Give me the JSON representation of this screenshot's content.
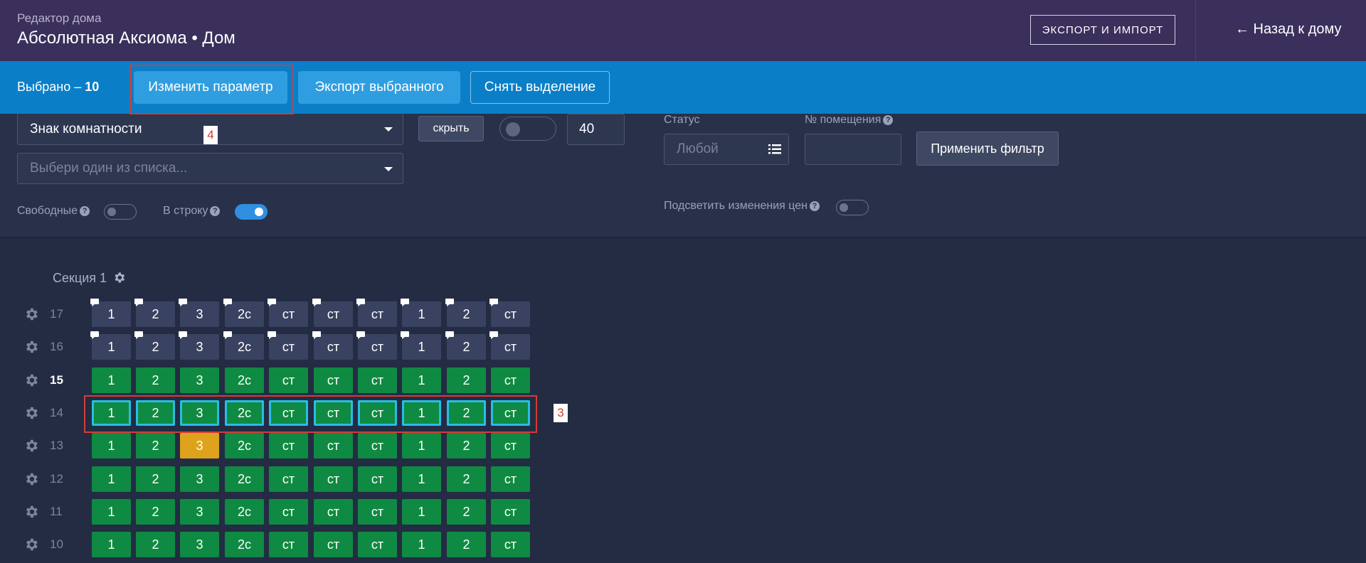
{
  "header": {
    "subtitle": "Редактор дома",
    "title": "Абсолютная Аксиома • Дом",
    "export_label": "ЭКСПОРТ И ИМПОРТ",
    "back_label": "← Назад к дому"
  },
  "selection": {
    "count_prefix": "Выбрано – ",
    "count": "10",
    "change_param": "Изменить параметр",
    "export_selected": "Экспорт выбранного",
    "clear_selection": "Снять выделение"
  },
  "annotations": {
    "label_4": "4",
    "label_3": "3"
  },
  "filters": {
    "room_sign": "Знак комнатности",
    "choose_placeholder": "Выбери один из списка...",
    "hide": "скрыть",
    "number": "40",
    "free_label": "Свободные",
    "inline_label": "В строку",
    "status_label": "Статус",
    "status_value": "Любой",
    "room_no_label": "№ помещения",
    "apply": "Применить фильтр",
    "highlight_label": "Подсветить изменения цен",
    "question": "?"
  },
  "section": {
    "title": "Секция 1",
    "rows": [
      {
        "floor": "17",
        "bold": false,
        "cells": [
          {
            "t": "1",
            "s": "empty"
          },
          {
            "t": "2",
            "s": "empty"
          },
          {
            "t": "3",
            "s": "empty"
          },
          {
            "t": "2с",
            "s": "empty"
          },
          {
            "t": "ст",
            "s": "empty"
          },
          {
            "t": "ст",
            "s": "empty"
          },
          {
            "t": "ст",
            "s": "empty"
          },
          {
            "t": "1",
            "s": "empty"
          },
          {
            "t": "2",
            "s": "empty"
          },
          {
            "t": "ст",
            "s": "empty"
          }
        ]
      },
      {
        "floor": "16",
        "bold": false,
        "cells": [
          {
            "t": "1",
            "s": "empty"
          },
          {
            "t": "2",
            "s": "empty"
          },
          {
            "t": "3",
            "s": "empty"
          },
          {
            "t": "2с",
            "s": "empty"
          },
          {
            "t": "ст",
            "s": "empty"
          },
          {
            "t": "ст",
            "s": "empty"
          },
          {
            "t": "ст",
            "s": "empty"
          },
          {
            "t": "1",
            "s": "empty"
          },
          {
            "t": "2",
            "s": "empty"
          },
          {
            "t": "ст",
            "s": "empty"
          }
        ]
      },
      {
        "floor": "15",
        "bold": true,
        "cells": [
          {
            "t": "1",
            "s": "green"
          },
          {
            "t": "2",
            "s": "green"
          },
          {
            "t": "3",
            "s": "green"
          },
          {
            "t": "2с",
            "s": "green"
          },
          {
            "t": "ст",
            "s": "green"
          },
          {
            "t": "ст",
            "s": "green"
          },
          {
            "t": "ст",
            "s": "green"
          },
          {
            "t": "1",
            "s": "green"
          },
          {
            "t": "2",
            "s": "green"
          },
          {
            "t": "ст",
            "s": "green"
          }
        ]
      },
      {
        "floor": "14",
        "bold": false,
        "cells": [
          {
            "t": "1",
            "s": "green sel"
          },
          {
            "t": "2",
            "s": "green sel"
          },
          {
            "t": "3",
            "s": "green sel"
          },
          {
            "t": "2с",
            "s": "green sel"
          },
          {
            "t": "ст",
            "s": "green sel"
          },
          {
            "t": "ст",
            "s": "green sel"
          },
          {
            "t": "ст",
            "s": "green sel"
          },
          {
            "t": "1",
            "s": "green sel"
          },
          {
            "t": "2",
            "s": "green sel"
          },
          {
            "t": "ст",
            "s": "green sel"
          }
        ]
      },
      {
        "floor": "13",
        "bold": false,
        "cells": [
          {
            "t": "1",
            "s": "green"
          },
          {
            "t": "2",
            "s": "green"
          },
          {
            "t": "3",
            "s": "orange"
          },
          {
            "t": "2с",
            "s": "green"
          },
          {
            "t": "ст",
            "s": "green"
          },
          {
            "t": "ст",
            "s": "green"
          },
          {
            "t": "ст",
            "s": "green"
          },
          {
            "t": "1",
            "s": "green"
          },
          {
            "t": "2",
            "s": "green"
          },
          {
            "t": "ст",
            "s": "green"
          }
        ]
      },
      {
        "floor": "12",
        "bold": false,
        "cells": [
          {
            "t": "1",
            "s": "green"
          },
          {
            "t": "2",
            "s": "green"
          },
          {
            "t": "3",
            "s": "green"
          },
          {
            "t": "2с",
            "s": "green"
          },
          {
            "t": "ст",
            "s": "green"
          },
          {
            "t": "ст",
            "s": "green"
          },
          {
            "t": "ст",
            "s": "green"
          },
          {
            "t": "1",
            "s": "green"
          },
          {
            "t": "2",
            "s": "green"
          },
          {
            "t": "ст",
            "s": "green"
          }
        ]
      },
      {
        "floor": "11",
        "bold": false,
        "cells": [
          {
            "t": "1",
            "s": "green"
          },
          {
            "t": "2",
            "s": "green"
          },
          {
            "t": "3",
            "s": "green"
          },
          {
            "t": "2с",
            "s": "green"
          },
          {
            "t": "ст",
            "s": "green"
          },
          {
            "t": "ст",
            "s": "green"
          },
          {
            "t": "ст",
            "s": "green"
          },
          {
            "t": "1",
            "s": "green"
          },
          {
            "t": "2",
            "s": "green"
          },
          {
            "t": "ст",
            "s": "green"
          }
        ]
      },
      {
        "floor": "10",
        "bold": false,
        "cells": [
          {
            "t": "1",
            "s": "green"
          },
          {
            "t": "2",
            "s": "green"
          },
          {
            "t": "3",
            "s": "green"
          },
          {
            "t": "2с",
            "s": "green"
          },
          {
            "t": "ст",
            "s": "green"
          },
          {
            "t": "ст",
            "s": "green"
          },
          {
            "t": "ст",
            "s": "green"
          },
          {
            "t": "1",
            "s": "green"
          },
          {
            "t": "2",
            "s": "green"
          },
          {
            "t": "ст",
            "s": "green"
          }
        ]
      }
    ]
  },
  "colors": {
    "header_bg": "#3b2f5c",
    "selection_bar": "#0a7fc7",
    "available": "#0f8a42",
    "reserved": "#dfa21d",
    "selected_outline": "#28bde6",
    "annotation": "#d63b34"
  }
}
